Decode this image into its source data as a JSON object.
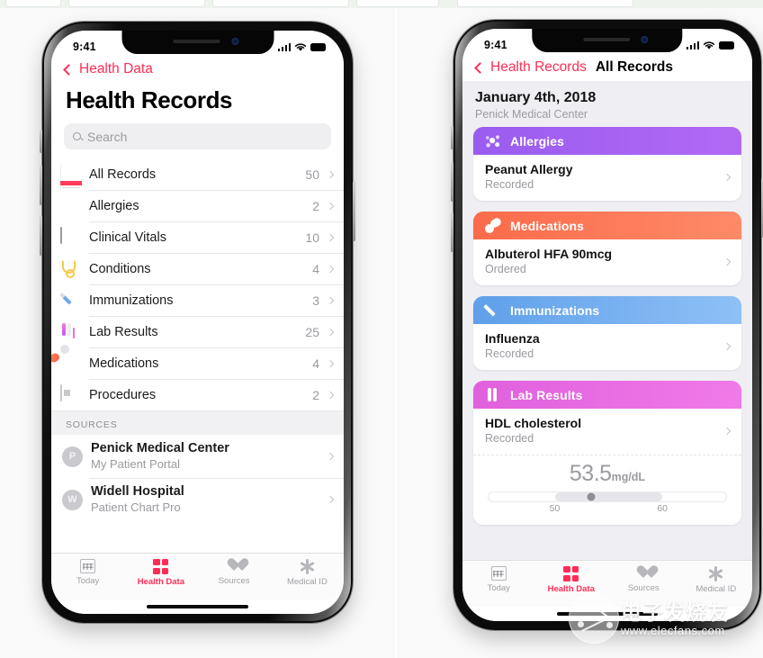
{
  "statusbar": {
    "time": "9:41",
    "signal_icon": "cellular-signal-icon",
    "wifi_icon": "wifi-icon",
    "battery_icon": "battery-icon"
  },
  "left_phone": {
    "nav": {
      "back_label": "Health Data",
      "back_icon": "chevron-left-icon"
    },
    "large_title": "Health Records",
    "search": {
      "placeholder": "Search",
      "icon": "search-icon"
    },
    "records": [
      {
        "icon": "all-records-icon",
        "label": "All Records",
        "count": "50"
      },
      {
        "icon": "allergies-icon",
        "label": "Allergies",
        "count": "2"
      },
      {
        "icon": "clinical-vitals-icon",
        "label": "Clinical Vitals",
        "count": "10"
      },
      {
        "icon": "conditions-icon",
        "label": "Conditions",
        "count": "4"
      },
      {
        "icon": "immunizations-icon",
        "label": "Immunizations",
        "count": "3"
      },
      {
        "icon": "lab-results-icon",
        "label": "Lab Results",
        "count": "25"
      },
      {
        "icon": "medications-icon",
        "label": "Medications",
        "count": "4"
      },
      {
        "icon": "procedures-icon",
        "label": "Procedures",
        "count": "2"
      }
    ],
    "sources_header": "SOURCES",
    "sources": [
      {
        "initial": "P",
        "name": "Penick Medical Center",
        "sub": "My Patient Portal"
      },
      {
        "initial": "W",
        "name": "Widell Hospital",
        "sub": "Patient Chart Pro"
      }
    ]
  },
  "right_phone": {
    "nav": {
      "back_label": "Health Records",
      "back_icon": "chevron-left-icon",
      "title": "All Records"
    },
    "date": "January 4th, 2018",
    "provider": "Penick Medical Center",
    "cards": [
      {
        "icon": "allergies-icon",
        "header": "Allergies",
        "color": "#a35ef2",
        "item_title": "Peanut Allergy",
        "item_sub": "Recorded"
      },
      {
        "icon": "medications-icon",
        "header": "Medications",
        "color": "#fb7355",
        "item_title": "Albuterol HFA 90mcg",
        "item_sub": "Ordered"
      },
      {
        "icon": "immunizations-icon",
        "header": "Immunizations",
        "color": "#6fabee",
        "item_title": "Influenza",
        "item_sub": "Recorded"
      },
      {
        "icon": "lab-results-icon",
        "header": "Lab Results",
        "color": "#e96ae2",
        "item_title": "HDL cholesterol",
        "item_sub": "Recorded"
      }
    ],
    "measurement": {
      "value": "53.5",
      "unit": "mg/dL",
      "tick_low": "50",
      "tick_high": "60"
    }
  },
  "tabbar": {
    "tabs": [
      {
        "icon": "today-calendar-icon",
        "label": "Today",
        "active": false
      },
      {
        "icon": "health-data-grid-icon",
        "label": "Health Data",
        "active": true
      },
      {
        "icon": "sources-heart-icon",
        "label": "Sources",
        "active": false
      },
      {
        "icon": "medical-id-star-icon",
        "label": "Medical ID",
        "active": false
      }
    ]
  },
  "watermark": {
    "brand": "电子发烧友",
    "url": "www.elecfans.com"
  },
  "colors": {
    "accent": "#ff2d55",
    "muted": "#9a9aa0",
    "panel_bg": "#f8f9f8",
    "records_bg": "#efeff3"
  }
}
